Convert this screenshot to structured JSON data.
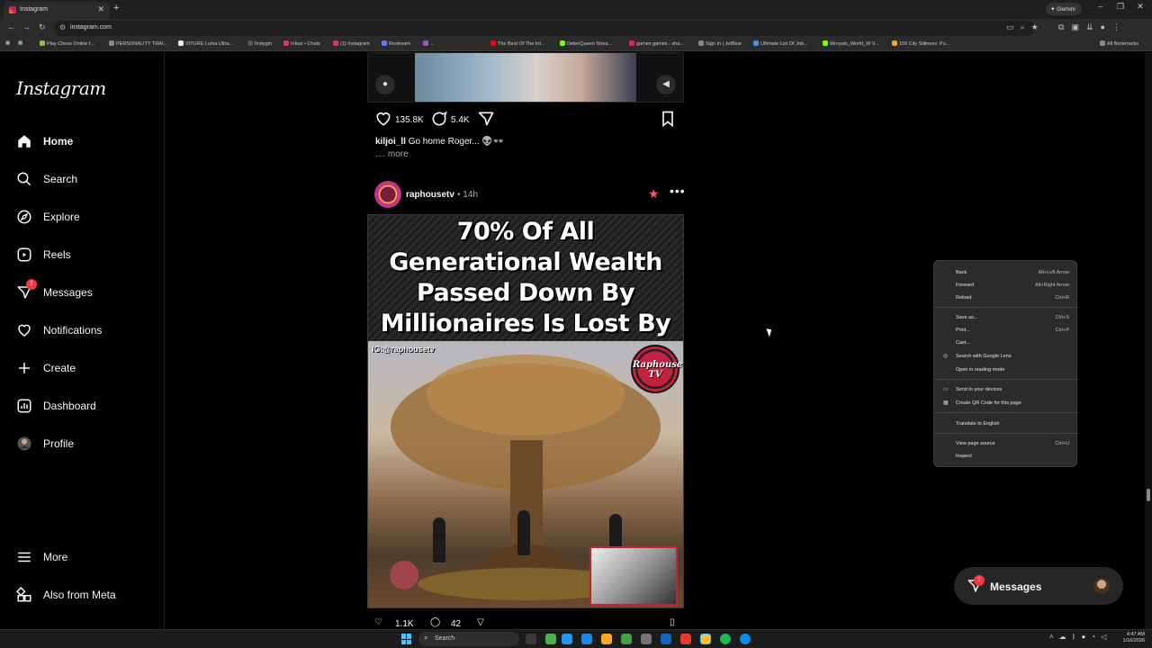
{
  "browser": {
    "tab_title": "Instagram",
    "new_tab_symbol": "+",
    "url": "instagram.com",
    "gemini_label": "Gemini",
    "bookmarks": [
      "Play Chess Online f...",
      "PERSONALITY TRAI...",
      "VITURE Luma Ultra...",
      "firstygiri",
      "Inbox • Chats",
      "(1) Instagram",
      "Restream",
      "...",
      "The Best Of The Int...",
      "DelenQueen Strea...",
      "games games - sha...",
      "Sign In | JetBlue",
      "Ultimate List Of Job...",
      "Wroyals_World_W V...",
      "150 City Silliness: Pu..."
    ],
    "all_bookmarks": "All Bookmarks"
  },
  "sidebar": {
    "logo": "Instagram",
    "items": [
      {
        "label": "Home",
        "icon": "home-icon",
        "active": true
      },
      {
        "label": "Search",
        "icon": "search-icon"
      },
      {
        "label": "Explore",
        "icon": "compass-icon"
      },
      {
        "label": "Reels",
        "icon": "reels-icon"
      },
      {
        "label": "Messages",
        "icon": "messenger-icon",
        "badge": "1"
      },
      {
        "label": "Notifications",
        "icon": "heart-icon"
      },
      {
        "label": "Create",
        "icon": "plus-icon"
      },
      {
        "label": "Dashboard",
        "icon": "dashboard-icon"
      },
      {
        "label": "Profile",
        "icon": "avatar-icon"
      }
    ],
    "more": "More",
    "also_from_meta": "Also from Meta"
  },
  "feed": {
    "prev_post": {
      "likes": "135.8K",
      "comments": "5.4K",
      "caption_user": "kiljoi_ll",
      "caption_text": "Go home Roger...",
      "more": ".... more"
    },
    "post": {
      "username": "raphousetv",
      "separator": "•",
      "time": "14h",
      "headline": "70% Of All Generational Wealth Passed Down By Millionaires Is Lost By The Second Generation",
      "ig_tag": "IG:@raphousetv",
      "logo_text": "Raphouse TV",
      "next_likes": "1.1K",
      "next_comments": "42"
    }
  },
  "context_menu": {
    "groups": [
      [
        {
          "label": "Back",
          "shortcut": "Alt+Left Arrow"
        },
        {
          "label": "Forward",
          "shortcut": "Alt+Right Arrow"
        },
        {
          "label": "Reload",
          "shortcut": "Ctrl+R"
        }
      ],
      [
        {
          "label": "Save as...",
          "shortcut": "Ctrl+S"
        },
        {
          "label": "Print...",
          "shortcut": "Ctrl+P"
        },
        {
          "label": "Cast...",
          "shortcut": ""
        },
        {
          "label": "Search with Google Lens",
          "shortcut": "",
          "icon": "lens-icon"
        },
        {
          "label": "Open in reading mode",
          "shortcut": ""
        }
      ],
      [
        {
          "label": "Send to your devices",
          "shortcut": "",
          "icon": "devices-icon"
        },
        {
          "label": "Create QR Code for this page",
          "shortcut": "",
          "icon": "qr-icon"
        }
      ],
      [
        {
          "label": "Translate to English",
          "shortcut": ""
        }
      ],
      [
        {
          "label": "View page source",
          "shortcut": "Ctrl+U"
        },
        {
          "label": "Inspect",
          "shortcut": ""
        }
      ]
    ]
  },
  "messages_pill": {
    "label": "Messages",
    "badge": "1"
  },
  "taskbar": {
    "search_placeholder": "Search",
    "time": "4:47 AM",
    "date": "1/16/2026"
  }
}
